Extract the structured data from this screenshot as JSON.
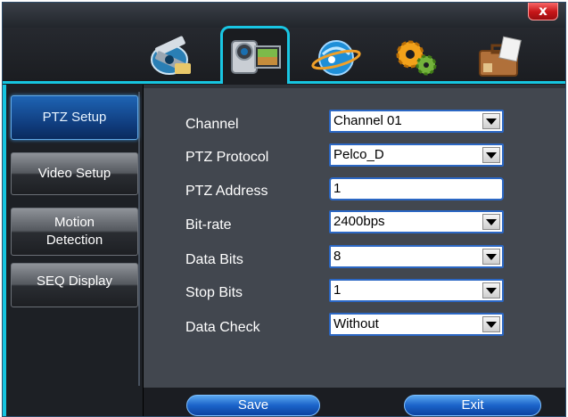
{
  "window": {
    "close_label": "x"
  },
  "tabs": [
    {
      "icon": "film-reel-icon"
    },
    {
      "icon": "camcorder-icon",
      "active": true
    },
    {
      "icon": "globe-network-icon"
    },
    {
      "icon": "gears-icon"
    },
    {
      "icon": "briefcase-icon"
    }
  ],
  "sidebar": {
    "items": [
      {
        "label": "PTZ Setup",
        "active": true
      },
      {
        "label": "Video Setup"
      },
      {
        "label": "Motion Detection",
        "line1": "Motion",
        "line2": "Detection"
      },
      {
        "label": "SEQ Display"
      }
    ]
  },
  "form": {
    "rows": [
      {
        "label": "Channel",
        "value": "Channel 01",
        "type": "select"
      },
      {
        "label": "PTZ Protocol",
        "value": "Pelco_D",
        "type": "select"
      },
      {
        "label": "PTZ Address",
        "value": "1",
        "type": "input"
      },
      {
        "label": "Bit-rate",
        "value": "2400bps",
        "type": "select"
      },
      {
        "label": "Data Bits",
        "value": "8",
        "type": "select"
      },
      {
        "label": "Stop Bits",
        "value": "1",
        "type": "select"
      },
      {
        "label": "Data Check",
        "value": "Without",
        "type": "select"
      }
    ]
  },
  "footer": {
    "save_label": "Save",
    "exit_label": "Exit"
  },
  "colors": {
    "accent": "#16c5e0",
    "active_tab": "#1e64b4",
    "panel": "#42474f",
    "button": "#1b63c9"
  }
}
